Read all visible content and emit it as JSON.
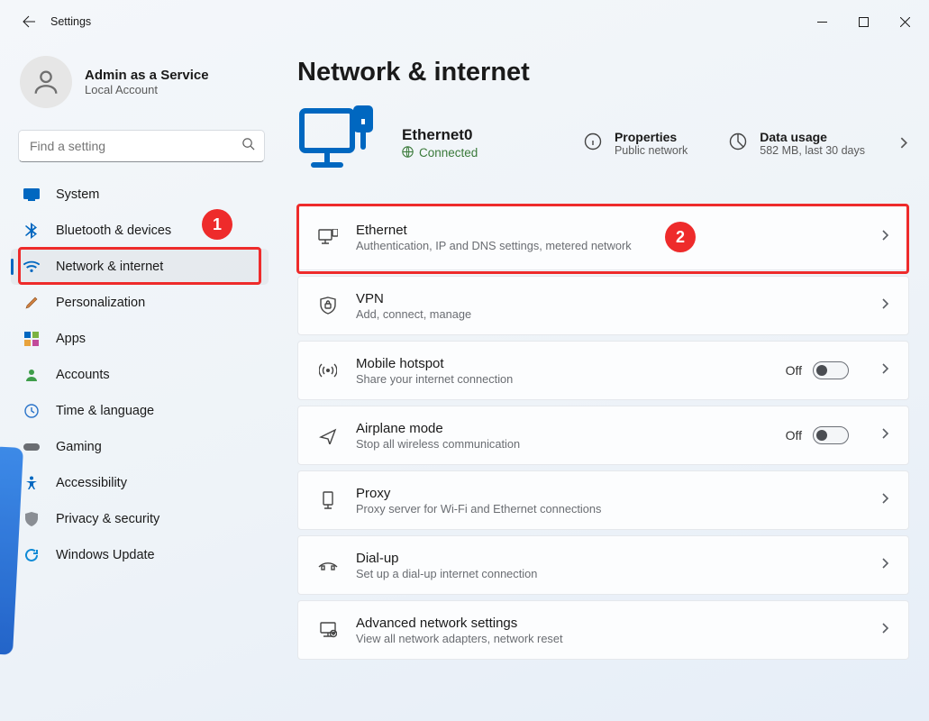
{
  "window": {
    "title": "Settings"
  },
  "profile": {
    "name": "Admin as a Service",
    "sub": "Local Account"
  },
  "search": {
    "placeholder": "Find a setting"
  },
  "sidebar": {
    "items": [
      {
        "label": "System"
      },
      {
        "label": "Bluetooth & devices"
      },
      {
        "label": "Network & internet"
      },
      {
        "label": "Personalization"
      },
      {
        "label": "Apps"
      },
      {
        "label": "Accounts"
      },
      {
        "label": "Time & language"
      },
      {
        "label": "Gaming"
      },
      {
        "label": "Accessibility"
      },
      {
        "label": "Privacy & security"
      },
      {
        "label": "Windows Update"
      }
    ]
  },
  "page": {
    "heading": "Network & internet"
  },
  "status": {
    "interface": "Ethernet0",
    "state": "Connected",
    "properties": {
      "title": "Properties",
      "sub": "Public network"
    },
    "usage": {
      "title": "Data usage",
      "sub": "582 MB, last 30 days"
    }
  },
  "cards": [
    {
      "title": "Ethernet",
      "sub": "Authentication, IP and DNS settings, metered network"
    },
    {
      "title": "VPN",
      "sub": "Add, connect, manage"
    },
    {
      "title": "Mobile hotspot",
      "sub": "Share your internet connection",
      "toggle": "Off"
    },
    {
      "title": "Airplane mode",
      "sub": "Stop all wireless communication",
      "toggle": "Off"
    },
    {
      "title": "Proxy",
      "sub": "Proxy server for Wi-Fi and Ethernet connections"
    },
    {
      "title": "Dial-up",
      "sub": "Set up a dial-up internet connection"
    },
    {
      "title": "Advanced network settings",
      "sub": "View all network adapters, network reset"
    }
  ],
  "annotations": {
    "badge1": "1",
    "badge2": "2"
  }
}
